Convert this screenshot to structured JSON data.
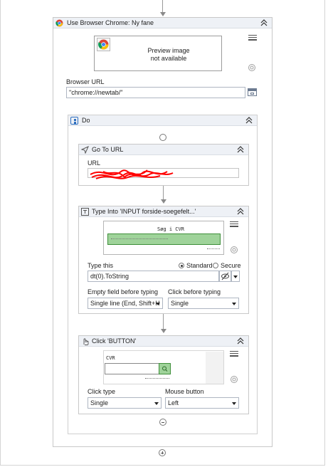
{
  "use_browser": {
    "title": "Use Browser Chrome: Ny fane",
    "preview_line1": "Preview image",
    "preview_line2": "not available",
    "url_label": "Browser URL",
    "url_value": "\"chrome://newtab/\"",
    "icons": [
      "chrome-icon",
      "hamburger-menu-icon",
      "target-settings-icon",
      "browse-icon",
      "collapse-chevrons-icon"
    ]
  },
  "do_sequence": {
    "title": "Do"
  },
  "go_to_url": {
    "title": "Go To URL",
    "url_label": "URL"
  },
  "type_into": {
    "title": "Type Into 'INPUT forside-soegefelt...'",
    "preview_heading": "Søg i CVR",
    "type_this_label": "Type this",
    "radio_standard": "Standard",
    "radio_secure": "Secure",
    "type_this_value": "dt(0).ToString",
    "empty_field_label": "Empty field before typing",
    "empty_field_value": "Single line (End, Shift+H",
    "click_before_label": "Click before typing",
    "click_before_value": "Single"
  },
  "click_button": {
    "title": "Click 'BUTTON'",
    "preview_heading": "CVR",
    "click_type_label": "Click type",
    "click_type_value": "Single",
    "mouse_button_label": "Mouse button",
    "mouse_button_value": "Left"
  },
  "colors": {
    "header_bg": "#eef1f6",
    "highlight_green": "#9fd39a",
    "redaction_red": "#ff0000"
  }
}
